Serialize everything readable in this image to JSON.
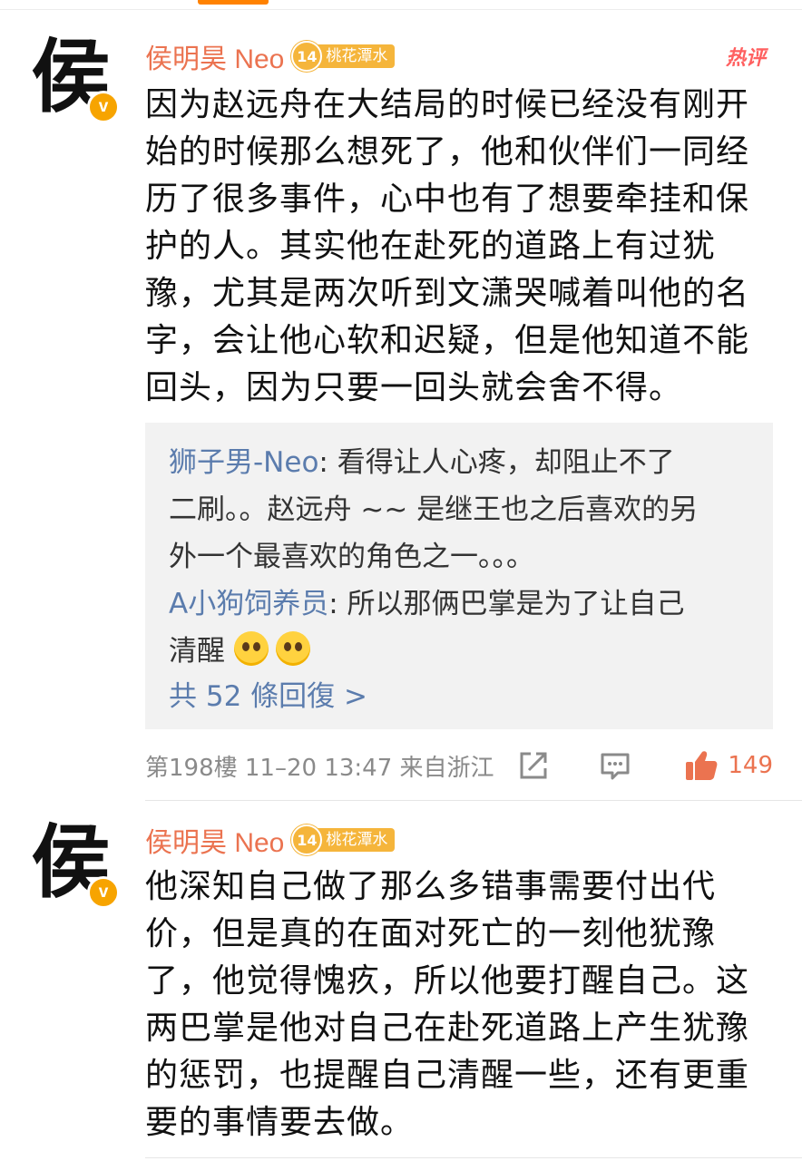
{
  "comments": [
    {
      "avatar_char": "侯",
      "verified_mark": "v",
      "username": "侯明昊 Neo",
      "level": "14",
      "badge_text": "桃花潭水",
      "hot_label": "热评",
      "lines": [
        "因为赵远舟在大结局的时候已经没有刚开",
        "始的时候那么想死了，他和伙伴们一同经",
        "历了很多事件，心中也有了想要牵挂和保",
        "护的人。其实他在赴死的道路上有过犹",
        "豫，尤其是两次听到文潇哭喊着叫他的名",
        "字，会让他心软和迟疑，但是他知道不能",
        "回头，因为只要一回头就会舍不得。"
      ],
      "replies": [
        {
          "name": "狮子男-Neo",
          "line1": "看得让人心疼，却阻止不了",
          "line2": "二刷。。赵远舟 ~~ 是继王也之后喜欢的另",
          "line3": "外一个最喜欢的角色之一。。。"
        },
        {
          "name": "A小狗饲养员",
          "line1": "所以那俩巴掌是为了让自己",
          "line2": "清醒"
        }
      ],
      "reply_more": "共 52 條回復 >",
      "meta": "第198樓  11–20 13:47  来自浙江",
      "likes": "149"
    },
    {
      "avatar_char": "侯",
      "verified_mark": "v",
      "username": "侯明昊 Neo",
      "level": "14",
      "badge_text": "桃花潭水",
      "lines": [
        "他深知自己做了那么多错事需要付出代",
        "价，但是真的在面对死亡的一刻他犹豫",
        "了，他觉得愧疚，所以他要打醒自己。这",
        "两巴掌是他对自己在赴死道路上产生犹豫",
        "的惩罚，也提醒自己清醒一些，还有更重",
        "要的事情要去做。"
      ]
    }
  ],
  "colors": {
    "username": "#eb7350",
    "badge": "#f5b53b",
    "reply_name": "#5b7cad",
    "reply_bg": "#f2f2f2",
    "like": "#eb7350",
    "hot": "#ff6060"
  },
  "icons": [
    "share-icon",
    "comment-icon",
    "thumbs-up-icon",
    "emoji-pleading-icon"
  ]
}
